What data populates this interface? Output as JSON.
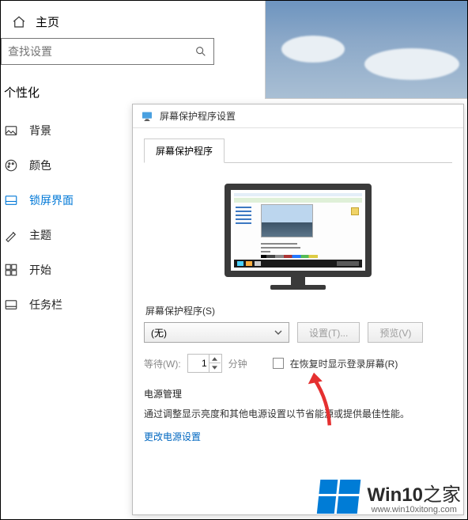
{
  "home_label": "主页",
  "search": {
    "placeholder": "查找设置"
  },
  "section_title": "个性化",
  "nav": [
    {
      "label": "背景"
    },
    {
      "label": "颜色"
    },
    {
      "label": "锁屏界面"
    },
    {
      "label": "主题"
    },
    {
      "label": "开始"
    },
    {
      "label": "任务栏"
    }
  ],
  "dialog": {
    "title": "屏幕保护程序设置",
    "tab": "屏幕保护程序",
    "ss_label": "屏幕保护程序(S)",
    "ss_select_value": "(无)",
    "settings_btn": "设置(T)...",
    "preview_btn": "预览(V)",
    "wait_label": "等待(W):",
    "wait_value": "1",
    "minutes_label": "分钟",
    "resume_checkbox": "在恢复时显示登录屏幕(R)",
    "power_header": "电源管理",
    "power_desc": "通过调整显示亮度和其他电源设置以节省能源或提供最佳性能。",
    "power_link": "更改电源设置"
  },
  "watermark": {
    "brand": "Win10",
    "suffix": "之家",
    "url": "www.win10xitong.com"
  }
}
